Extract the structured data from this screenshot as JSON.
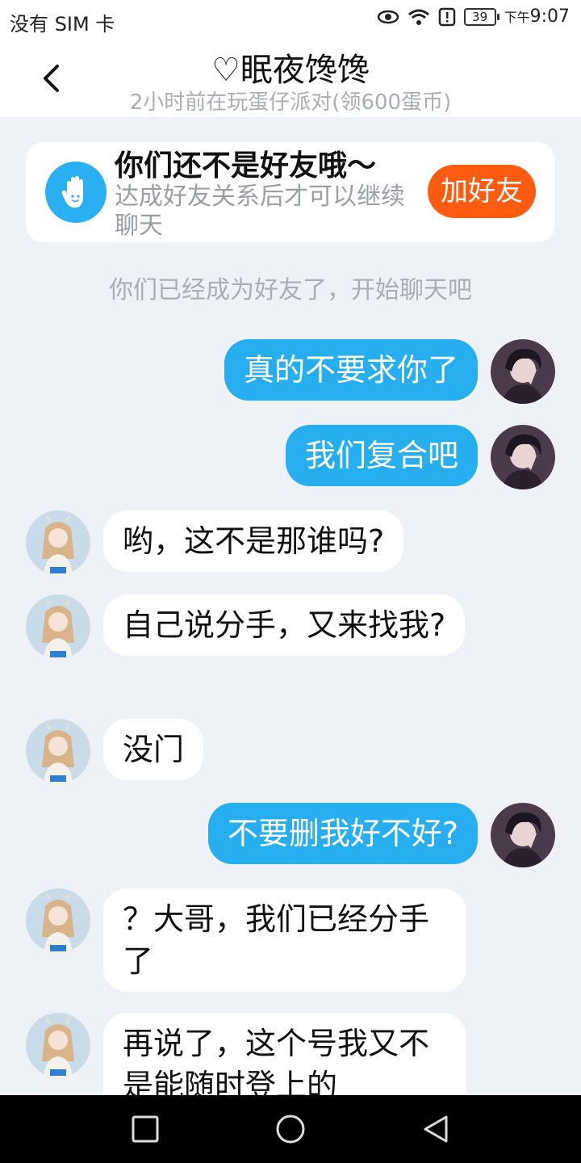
{
  "status_bar": {
    "carrier": "没有 SIM 卡",
    "battery": "39",
    "time_prefix": "下午",
    "time": "9:07",
    "icons": [
      "eye-icon",
      "wifi-icon",
      "alert-icon",
      "battery-icon"
    ]
  },
  "header": {
    "title": "♡眠夜馋馋",
    "subtitle": "2小时前在玩蛋仔派对(领600蛋币)",
    "back_icon": "chevron-left-icon"
  },
  "friend_card": {
    "title": "你们还不是好友哦～",
    "description": "达成好友关系后才可以继续聊天",
    "button": "加好友",
    "icon": "wave-hand-icon",
    "button_color": "#ff5c12"
  },
  "system_message": "你们已经成为好友了，开始聊天吧",
  "messages": [
    {
      "from": "me",
      "text": "真的不要求你了"
    },
    {
      "from": "me",
      "text": "我们复合吧"
    },
    {
      "from": "them",
      "text": "哟，这不是那谁吗?"
    },
    {
      "from": "them",
      "text": "自己说分手，又来找我?"
    },
    {
      "from": "them",
      "text": "没门"
    },
    {
      "from": "me",
      "text": "不要删我好不好?"
    },
    {
      "from": "them",
      "text": "？大哥，我们已经分手了"
    },
    {
      "from": "them",
      "text": "再说了，这个号我又不是能随时登上的"
    }
  ],
  "colors": {
    "my_bubble": "#26aef0",
    "their_bubble": "#ffffff",
    "background": "#eef1f6"
  },
  "nav_bar": {
    "icons": [
      "recent-apps-icon",
      "home-icon",
      "back-icon"
    ]
  }
}
